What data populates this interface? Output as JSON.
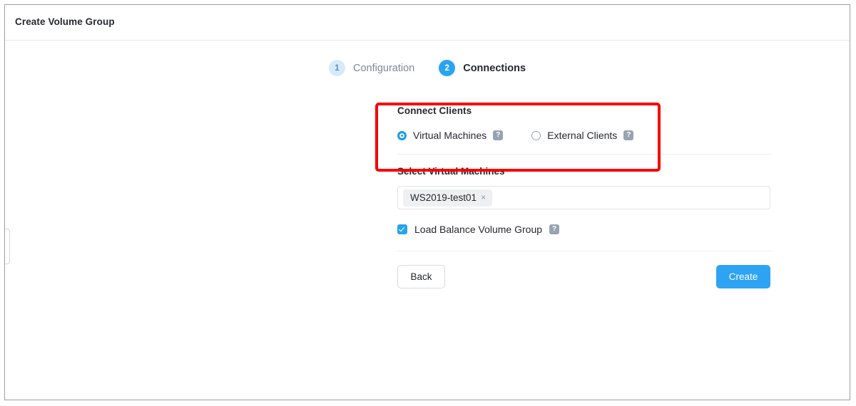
{
  "window": {
    "title": "Create Volume Group",
    "edge_handle_name": "panel-collapse-handle"
  },
  "stepper": {
    "steps": [
      {
        "number": "1",
        "label": "Configuration",
        "state": "inactive"
      },
      {
        "number": "2",
        "label": "Connections",
        "state": "active"
      }
    ]
  },
  "form": {
    "connect_clients": {
      "title": "Connect Clients",
      "options": [
        {
          "label": "Virtual Machines",
          "selected": true,
          "help": "?"
        },
        {
          "label": "External Clients",
          "selected": false,
          "help": "?"
        }
      ]
    },
    "select_vms": {
      "label": "Select Virtual Machines",
      "tags": [
        {
          "text": "WS2019-test01",
          "remove": "×"
        }
      ],
      "placeholder": ""
    },
    "load_balance": {
      "label": "Load Balance Volume Group",
      "checked": true,
      "help": "?"
    },
    "actions": {
      "back_label": "Back",
      "create_label": "Create"
    }
  },
  "annotation": {
    "highlight_color": "#fb0000",
    "target": "connect-clients-section"
  },
  "colors": {
    "accent": "#27a4f2",
    "step_inactive_bg": "#d5eafb",
    "help_badge": "#97a3b2",
    "tag_bg": "#eef0f2",
    "border": "#dfe2e5"
  }
}
